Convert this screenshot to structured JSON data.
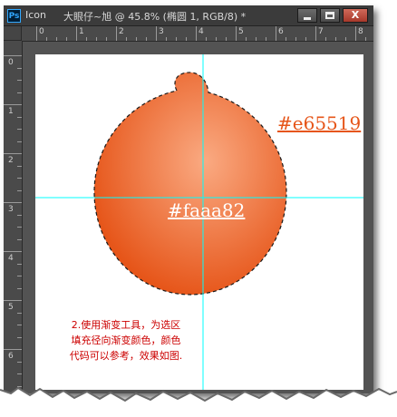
{
  "window": {
    "app_name": "Icon",
    "document_title": "大眼仔~旭 @ 45.8% (椭圆 1, RGB/8) *",
    "ps_badge": "Ps",
    "close_glyph": "X"
  },
  "rulers": {
    "horizontal_labels": [
      "0",
      "1",
      "2",
      "3",
      "4",
      "5",
      "6",
      "7",
      "8"
    ],
    "vertical_labels": [
      "0",
      "1",
      "2",
      "3",
      "4",
      "5",
      "6",
      "7"
    ]
  },
  "canvas": {
    "color_outer_label": "#e65519",
    "color_inner_label": "#faaa82",
    "outer_color": "#e65519",
    "inner_color": "#faaa82",
    "instruction_lines": [
      "2.使用渐变工具，为选区",
      "填充径向渐变颜色，颜色",
      "代码可以参考，效果如图."
    ],
    "guide_color": "#00ffff",
    "instruction_color": "#cc0000"
  }
}
